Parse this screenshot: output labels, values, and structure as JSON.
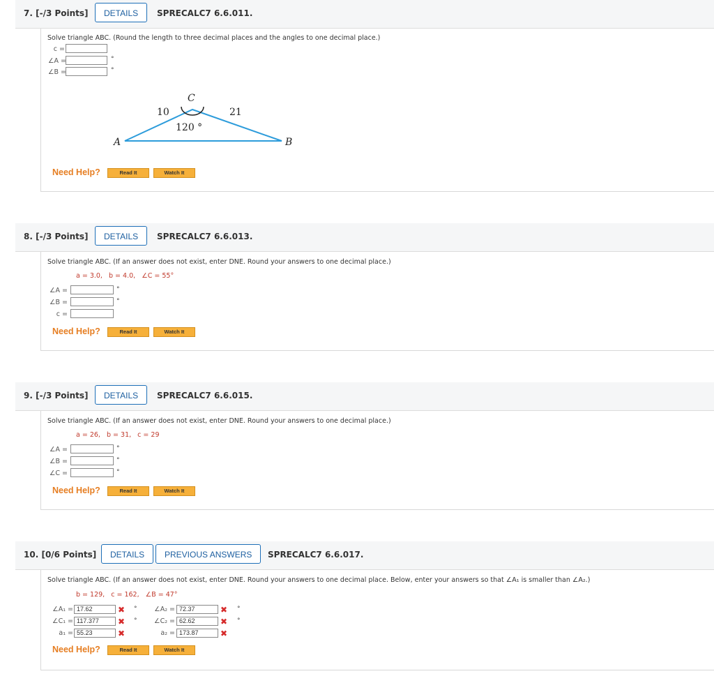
{
  "questions": [
    {
      "number": "7.",
      "points": "[-/3 Points]",
      "details_label": "DETAILS",
      "code": "SPRECALC7 6.6.011.",
      "instruction": "Solve triangle ABC. (Round the length to three decimal places and the angles to one decimal place.)",
      "fields": [
        {
          "label": "c =",
          "value": "",
          "unit": ""
        },
        {
          "label": "∠A =",
          "value": "",
          "unit": "°"
        },
        {
          "label": "∠B =",
          "value": "",
          "unit": "°"
        }
      ],
      "figure": {
        "vertex_a": "A",
        "vertex_b": "B",
        "vertex_c": "C",
        "side_ca": "10",
        "side_cb": "21",
        "angle_c": "120 °"
      },
      "need_help": "Need Help?",
      "read_it": "Read It",
      "watch_it": "Watch It"
    },
    {
      "number": "8.",
      "points": "[-/3 Points]",
      "details_label": "DETAILS",
      "code": "SPRECALC7 6.6.013.",
      "instruction": "Solve triangle ABC. (If an answer does not exist, enter DNE. Round your answers to one decimal place.)",
      "givens": "a = 3.0,   b = 4.0,   ∠C = 55°",
      "fields": [
        {
          "label": "∠A =",
          "value": "",
          "unit": "°"
        },
        {
          "label": "∠B =",
          "value": "",
          "unit": "°"
        },
        {
          "label": "c =",
          "value": "",
          "unit": ""
        }
      ],
      "need_help": "Need Help?",
      "read_it": "Read It",
      "watch_it": "Watch It"
    },
    {
      "number": "9.",
      "points": "[-/3 Points]",
      "details_label": "DETAILS",
      "code": "SPRECALC7 6.6.015.",
      "instruction": "Solve triangle ABC. (If an answer does not exist, enter DNE. Round your answers to one decimal place.)",
      "givens": "a = 26,   b = 31,   c = 29",
      "fields": [
        {
          "label": "∠A =",
          "value": "",
          "unit": "°"
        },
        {
          "label": "∠B =",
          "value": "",
          "unit": "°"
        },
        {
          "label": "∠C =",
          "value": "",
          "unit": "°"
        }
      ],
      "need_help": "Need Help?",
      "read_it": "Read It",
      "watch_it": "Watch It"
    },
    {
      "number": "10.",
      "points": "[0/6 Points]",
      "details_label": "DETAILS",
      "previous_label": "PREVIOUS ANSWERS",
      "code": "SPRECALC7 6.6.017.",
      "instruction": "Solve triangle ABC. (If an answer does not exist, enter DNE. Round your answers to one decimal place. Below, enter your answers so that ∠A₁ is smaller than ∠A₂.)",
      "givens": "b = 129,   c = 162,   ∠B = 47°",
      "left_fields": [
        {
          "label": "∠A₁ =",
          "value": "17.62",
          "unit": "°",
          "status": "incorrect"
        },
        {
          "label": "∠C₁ =",
          "value": "117.377",
          "unit": "°",
          "status": "incorrect"
        },
        {
          "label": "a₁ =",
          "value": "55.23",
          "unit": "",
          "status": "incorrect"
        }
      ],
      "right_fields": [
        {
          "label": "∠A₂ =",
          "value": "72.37",
          "unit": "°",
          "status": "incorrect"
        },
        {
          "label": "∠C₂ =",
          "value": "62.62",
          "unit": "°",
          "status": "incorrect"
        },
        {
          "label": "a₂ =",
          "value": "173.87",
          "unit": "",
          "status": "incorrect"
        }
      ],
      "need_help": "Need Help?",
      "read_it": "Read It",
      "watch_it": "Watch It"
    }
  ],
  "icons": {
    "wrong": "✖"
  },
  "colors": {
    "accent": "#1d6fb8",
    "help": "#e67e22",
    "wrong": "#d62b2b",
    "given": "#c0392b"
  }
}
